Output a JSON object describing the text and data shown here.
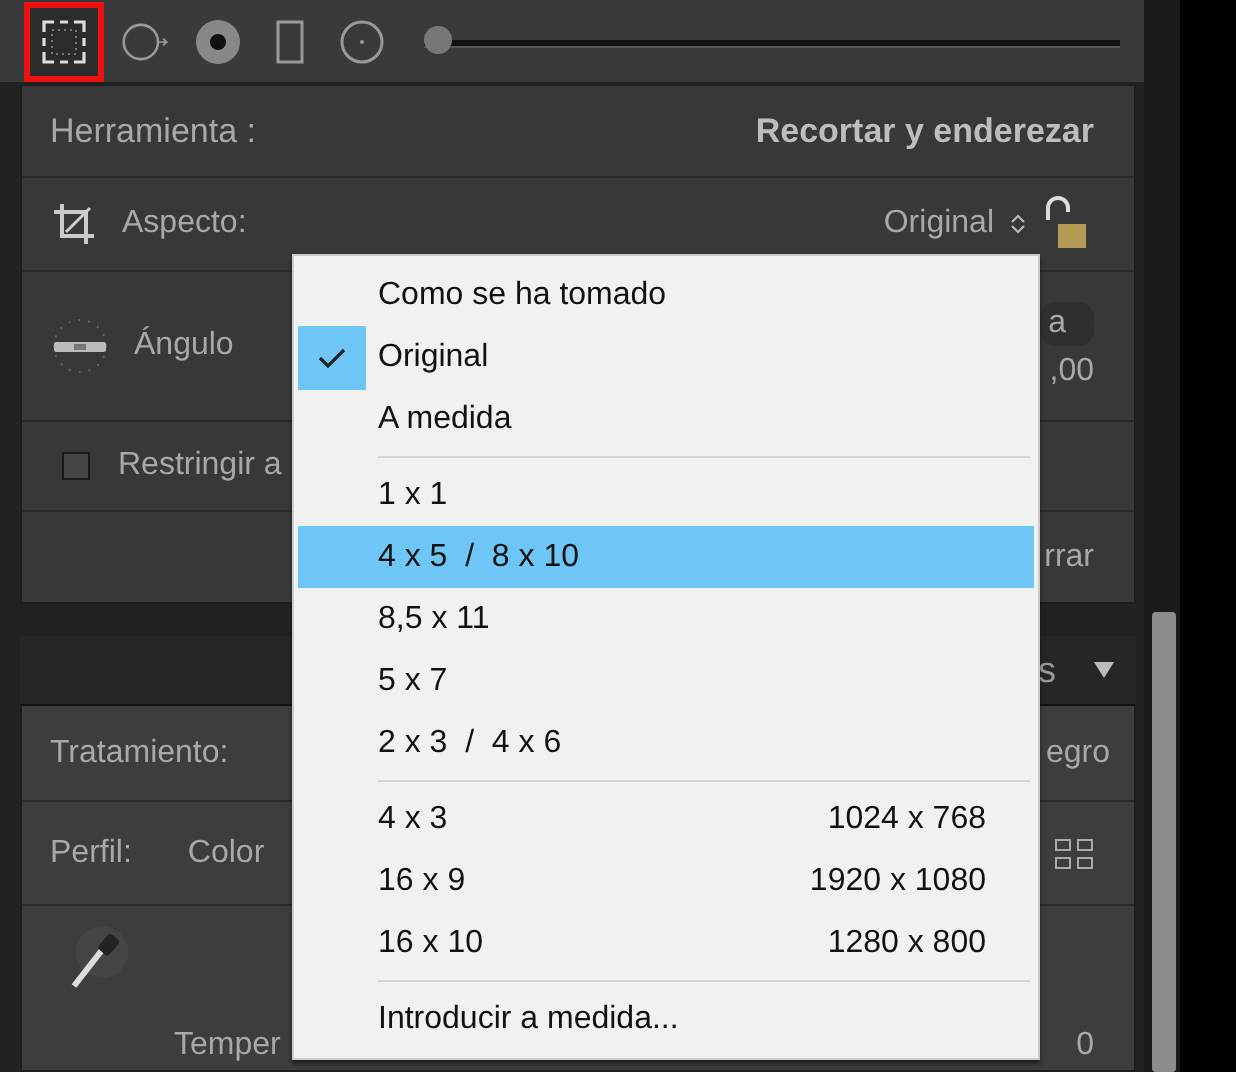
{
  "toolbar": {
    "tools": [
      {
        "kind": "crop",
        "selected": true
      },
      {
        "kind": "spot",
        "selected": false
      },
      {
        "kind": "redeye",
        "selected": false
      },
      {
        "kind": "graduated",
        "selected": false
      },
      {
        "kind": "radial",
        "selected": false
      }
    ],
    "slider": {
      "level": 0
    }
  },
  "crop_panel": {
    "tool_label": "Herramienta :",
    "tool_name": "Recortar y enderezar",
    "aspect_label": "Aspecto:",
    "aspect_value": "Original",
    "locked": false,
    "angle_label": "Ángulo",
    "angle_button": "a",
    "angle_value": ",00",
    "constrain_label": "Restringir a",
    "constrain_checked": false,
    "reset_button": "rrar"
  },
  "section_header": {
    "title": "s",
    "expanded": true
  },
  "basic_panel": {
    "treatment_label": "Tratamiento:",
    "treatment_value": "egro",
    "profile_label": "Perfil:",
    "profile_value": "Color",
    "temperature_label": "Temper",
    "temperature_value": "0"
  },
  "menu": {
    "groups": [
      [
        {
          "label": "Como se ha tomado",
          "checked": false,
          "selected": false
        },
        {
          "label": "Original",
          "checked": true,
          "selected": false
        },
        {
          "label": "A medida",
          "checked": false,
          "selected": false
        }
      ],
      [
        {
          "label": "1 x 1",
          "checked": false,
          "selected": false
        },
        {
          "label": "4 x 5  /  8 x 10",
          "checked": false,
          "selected": true
        },
        {
          "label": "8,5 x 11",
          "checked": false,
          "selected": false
        },
        {
          "label": "5 x 7",
          "checked": false,
          "selected": false
        },
        {
          "label": "2 x 3  /  4 x 6",
          "checked": false,
          "selected": false
        }
      ],
      [
        {
          "label": "4 x 3",
          "size": "1024 x 768",
          "checked": false,
          "selected": false
        },
        {
          "label": "16 x 9",
          "size": "1920 x 1080",
          "checked": false,
          "selected": false
        },
        {
          "label": "16 x 10",
          "size": "1280 x 800",
          "checked": false,
          "selected": false
        }
      ],
      [
        {
          "label": "Introducir a medida...",
          "checked": false,
          "selected": false
        }
      ]
    ]
  }
}
